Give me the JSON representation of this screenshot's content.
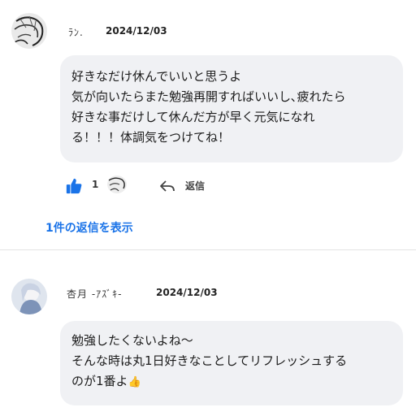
{
  "comments": [
    {
      "author": "ﾗﾝ.",
      "date": "2024/12/03",
      "lines": [
        "好きなだけ休んでいいと思うよ",
        "気が向いたらまた勉強再開すればいいし､疲れたら",
        "好きな事だけして休んだ方が早く元気になれ",
        "る！！！体調気をつけてね！"
      ],
      "like_count": "1",
      "reply_label": "返信",
      "show_replies": "1件の返信を表示"
    },
    {
      "author": "杏月 -ｱｽﾞｷ-",
      "date": "2024/12/03",
      "lines": [
        "勉強したくないよね〜",
        "そんな時は丸1日好きなことしてリフレッシュする",
        "のが1番よ"
      ],
      "emoji": "👍"
    }
  ],
  "colors": {
    "link": "#1a73e8",
    "like": "#1a73e8",
    "bubble": "#f0f1f4"
  }
}
